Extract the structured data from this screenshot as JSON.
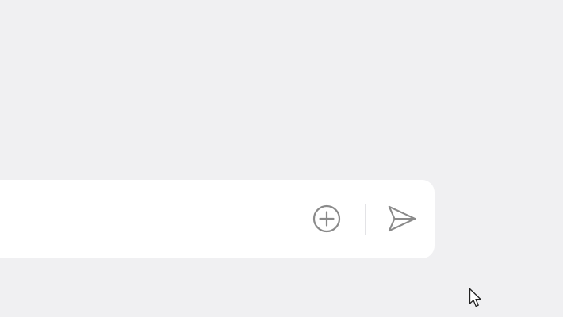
{
  "composer": {
    "placeholder": "",
    "value": ""
  },
  "icons": {
    "attach": "plus-circle-icon",
    "send": "send-icon",
    "cursor": "mouse-pointer-icon"
  },
  "colors": {
    "background": "#f0f0f2",
    "composer_bg": "#ffffff",
    "icon": "#8a8a8a",
    "divider": "#e3e3e6"
  }
}
